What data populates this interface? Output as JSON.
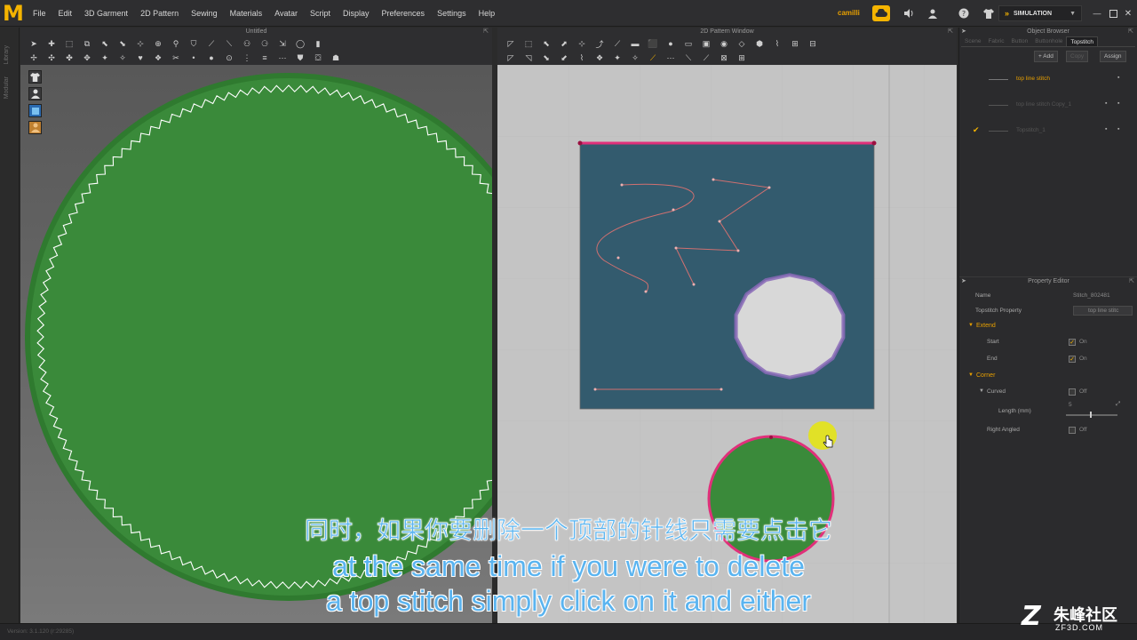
{
  "app": {
    "logo_letter": "M",
    "menu": [
      "File",
      "Edit",
      "3D Garment",
      "2D Pattern",
      "Sewing",
      "Materials",
      "Avatar",
      "Script",
      "Display",
      "Preferences",
      "Settings",
      "Help"
    ],
    "user": "camilli",
    "simulation_label": "SIMULATION",
    "accent_color": "#f5b400"
  },
  "left_strip": {
    "labels": [
      "Library",
      "Modular"
    ]
  },
  "win3d": {
    "title": "Untitled",
    "fabric_color": "#3a8a3a",
    "stitch_color": "#ffffff"
  },
  "win2d": {
    "title": "2D Pattern Window",
    "pattern_fill": "#335b6e",
    "stitch_color": "#e0307a",
    "line_color": "#d07070"
  },
  "object_browser": {
    "title": "Object Browser",
    "tabs": [
      "Scene",
      "Fabric",
      "Button",
      "Buttonhole",
      "Topstitch"
    ],
    "active_tab": "Topstitch",
    "add_label": "+ Add",
    "copy_label": "Copy",
    "assign_label": "Assign",
    "items": [
      {
        "name": "top line stitch",
        "active": true
      },
      {
        "name": "top line stitch Copy_1",
        "active": false
      },
      {
        "name": "Topstitch_1",
        "active": false
      }
    ]
  },
  "property_editor": {
    "title": "Property Editor",
    "name_label": "Name",
    "name_value": "Stitch_802481",
    "topstitch_label": "Topstitch Property",
    "topstitch_value": "top line stitc",
    "extend_label": "Extend",
    "start_label": "Start",
    "start_value": "On",
    "end_label": "End",
    "end_value": "On",
    "corner_label": "Corner",
    "curved_label": "Curved",
    "curved_value": "Off",
    "length_label": "Length (mm)",
    "length_value": "5",
    "right_angled_label": "Right Angled",
    "right_angled_value": "Off"
  },
  "status_bar": {
    "text": "Version: 3.1.120   (r:29285)"
  },
  "subtitles": {
    "cn": "同时，如果你要删除一个顶部的针线只需要点击它",
    "en1": "at the same time if you were to delete",
    "en2": "a top stitch simply click on it and either"
  },
  "watermark": {
    "logo": "Z",
    "cn": "朱峰社区",
    "url": "ZF3D.COM"
  }
}
